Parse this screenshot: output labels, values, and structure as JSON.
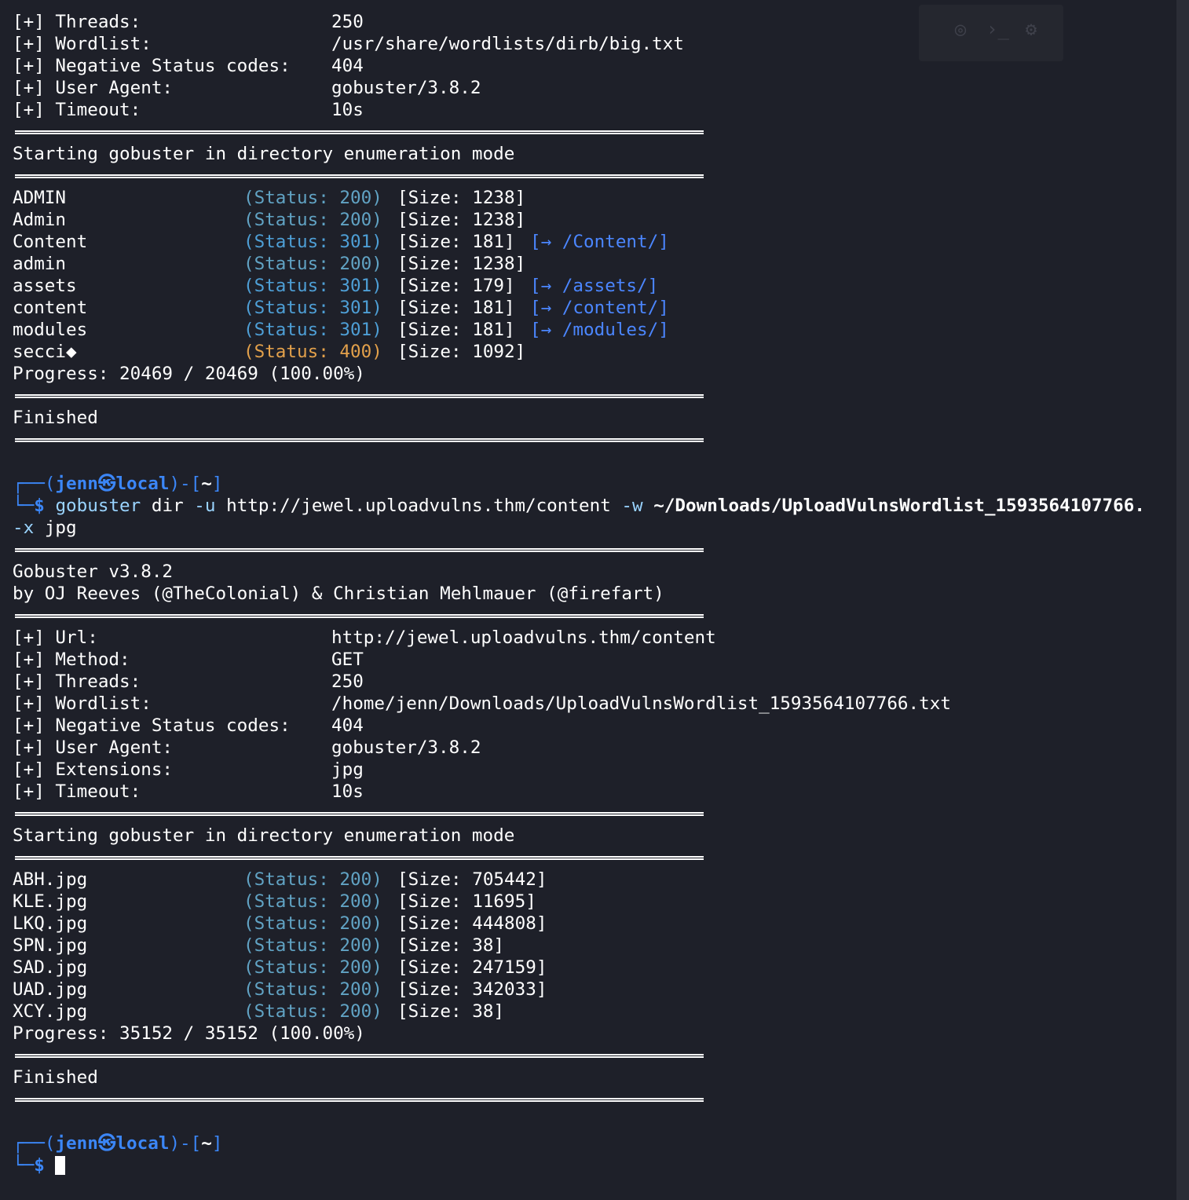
{
  "colors": {
    "background": "#1e2029",
    "status_ok": "#61a3c4",
    "status_redirect": "#4e9fd6",
    "status_bad_request": "#e3a14b",
    "redirect_path": "#4b86ff",
    "prompt": "#3b86f7"
  },
  "scan1": {
    "config": [
      {
        "label": "[+] Threads:",
        "value": "250"
      },
      {
        "label": "[+] Wordlist:",
        "value": "/usr/share/wordlists/dirb/big.txt"
      },
      {
        "label": "[+] Negative Status codes:",
        "value": "404"
      },
      {
        "label": "[+] User Agent:",
        "value": "gobuster/3.8.2"
      },
      {
        "label": "[+] Timeout:",
        "value": "10s"
      }
    ],
    "start_msg": "Starting gobuster in directory enumeration mode",
    "results": [
      {
        "name": "ADMIN",
        "status": "(Status: 200)",
        "size": "[Size: 1238]",
        "redirect": ""
      },
      {
        "name": "Admin",
        "status": "(Status: 200)",
        "size": "[Size: 1238]",
        "redirect": ""
      },
      {
        "name": "Content",
        "status": "(Status: 301)",
        "size": "[Size: 181]",
        "redirect": "[→ /Content/]"
      },
      {
        "name": "admin",
        "status": "(Status: 200)",
        "size": "[Size: 1238]",
        "redirect": ""
      },
      {
        "name": "assets",
        "status": "(Status: 301)",
        "size": "[Size: 179]",
        "redirect": "[→ /assets/]"
      },
      {
        "name": "content",
        "status": "(Status: 301)",
        "size": "[Size: 181]",
        "redirect": "[→ /content/]"
      },
      {
        "name": "modules",
        "status": "(Status: 301)",
        "size": "[Size: 181]",
        "redirect": "[→ /modules/]"
      },
      {
        "name": "secci◆",
        "status": "(Status: 400)",
        "size": "[Size: 1092]",
        "redirect": ""
      }
    ],
    "progress": "Progress: 20469 / 20469 (100.00%)",
    "finished": "Finished"
  },
  "prompt1": {
    "corner_top": "┌──",
    "open": "(",
    "user": "jenn",
    "at": "㉿",
    "host": "local",
    "close": ")-[",
    "dir": "~",
    "end": "]",
    "corner_bottom": "└─",
    "dollar": "$",
    "cmd": "gobuster",
    "args1": " dir ",
    "flag_u": "-u",
    "url": " http://jewel.uploadvulns.thm/content ",
    "flag_w": "-w",
    "wordlist": " ~/Downloads/UploadVulnsWordlist_1593564107766.",
    "flag_x": "-x",
    "ext": " jpg"
  },
  "banner": {
    "version": "Gobuster v3.8.2",
    "authors": "by OJ Reeves (@TheColonial) & Christian Mehlmauer (@firefart)"
  },
  "scan2": {
    "config": [
      {
        "label": "[+] Url:",
        "value": "http://jewel.uploadvulns.thm/content"
      },
      {
        "label": "[+] Method:",
        "value": "GET"
      },
      {
        "label": "[+] Threads:",
        "value": "250"
      },
      {
        "label": "[+] Wordlist:",
        "value": "/home/jenn/Downloads/UploadVulnsWordlist_1593564107766.txt"
      },
      {
        "label": "[+] Negative Status codes:",
        "value": "404"
      },
      {
        "label": "[+] User Agent:",
        "value": "gobuster/3.8.2"
      },
      {
        "label": "[+] Extensions:",
        "value": "jpg"
      },
      {
        "label": "[+] Timeout:",
        "value": "10s"
      }
    ],
    "start_msg": "Starting gobuster in directory enumeration mode",
    "results": [
      {
        "name": "ABH.jpg",
        "status": "(Status: 200)",
        "size": "[Size: 705442]"
      },
      {
        "name": "KLE.jpg",
        "status": "(Status: 200)",
        "size": "[Size: 11695]"
      },
      {
        "name": "LKQ.jpg",
        "status": "(Status: 200)",
        "size": "[Size: 444808]"
      },
      {
        "name": "SPN.jpg",
        "status": "(Status: 200)",
        "size": "[Size: 38]"
      },
      {
        "name": "SAD.jpg",
        "status": "(Status: 200)",
        "size": "[Size: 247159]"
      },
      {
        "name": "UAD.jpg",
        "status": "(Status: 200)",
        "size": "[Size: 342033]"
      },
      {
        "name": "XCY.jpg",
        "status": "(Status: 200)",
        "size": "[Size: 38]"
      }
    ],
    "progress": "Progress: 35152 / 35152 (100.00%)",
    "finished": "Finished"
  },
  "prompt2": {
    "corner_top": "┌──",
    "open": "(",
    "user": "jenn",
    "at": "㉿",
    "host": "local",
    "close": ")-[",
    "dir": "~",
    "end": "]",
    "corner_bottom": "└─",
    "dollar": "$"
  },
  "icons": [
    "globe-icon",
    "terminal-icon",
    "gear-icon"
  ]
}
